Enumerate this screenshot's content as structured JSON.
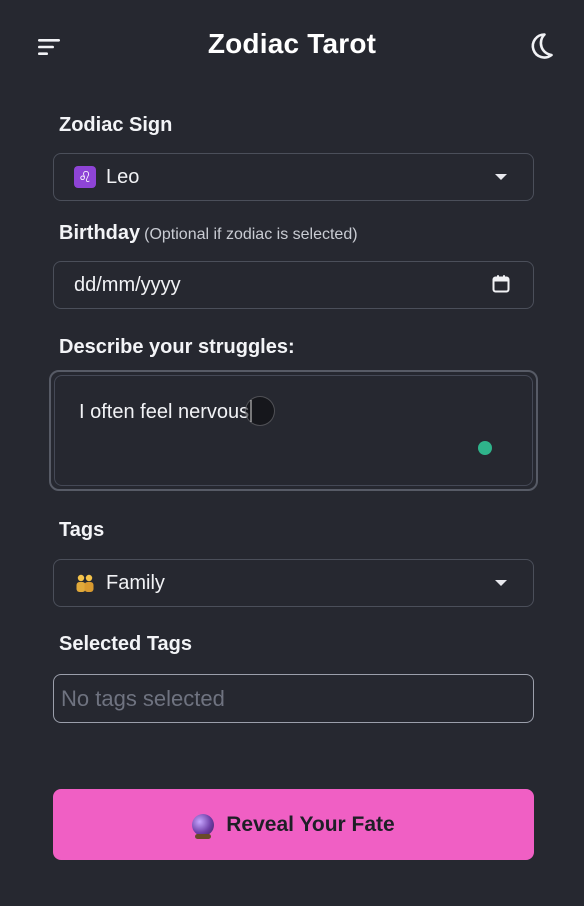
{
  "header": {
    "title": "Zodiac Tarot",
    "menu_icon": "hamburger-menu-icon",
    "theme_icon": "moon-icon"
  },
  "zodiac": {
    "label": "Zodiac Sign",
    "icon": "leo-icon",
    "icon_glyph": "♌",
    "icon_color": "#8e44d6",
    "value": "Leo"
  },
  "birthday": {
    "label": "Birthday",
    "hint": "(Optional if zodiac is selected)",
    "placeholder": "dd/mm/yyyy",
    "icon": "calendar-icon"
  },
  "struggles": {
    "label": "Describe your struggles:",
    "value": "I often feel nervous"
  },
  "tags": {
    "label": "Tags",
    "icon": "family-icon",
    "value": "Family"
  },
  "selected_tags": {
    "label": "Selected Tags",
    "placeholder": "No tags selected"
  },
  "reveal": {
    "label": "Reveal Your Fate",
    "icon": "crystal-ball-icon",
    "color": "#f05fc4"
  },
  "colors": {
    "background": "#262830",
    "status_dot": "#2fb48b"
  }
}
